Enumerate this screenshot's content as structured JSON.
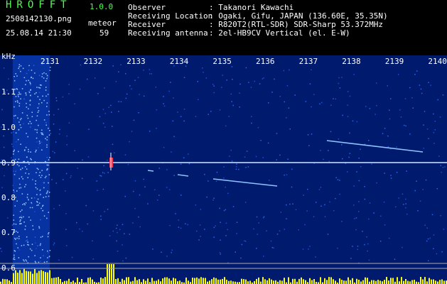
{
  "header": {
    "logo": "HROFFT",
    "version": "1.0.0",
    "filename": "2508142130.png",
    "datetime": "25.08.14 21:30",
    "event_label": "meteor",
    "event_count": "59"
  },
  "meta": [
    {
      "key": "Observer",
      "value": ": Takanori Kawachi"
    },
    {
      "key": "Receiving Location",
      "value": ": Ogaki, Gifu, JAPAN (136.60E, 35.35N)"
    },
    {
      "key": "Receiver",
      "value": ": R820T2(RTL-SDR) SDR-Sharp 53.372MHz"
    },
    {
      "key": "Receiving antenna",
      "value": ": 2el-HB9CV Vertical (el. E-W)"
    }
  ],
  "axis": {
    "y_unit": "kHz",
    "y_ticks": [
      "1.1",
      "1.0",
      "0.9",
      "0.8",
      "0.7",
      "0.6"
    ],
    "x_ticks": [
      "2131",
      "2132",
      "2133",
      "2134",
      "2135",
      "2136",
      "2137",
      "2138",
      "2139",
      "2140"
    ]
  },
  "colors": {
    "background": "#000000",
    "spectrum_bg": "#001a6e",
    "carrier": "#cfe8ff",
    "meteor_trail": "#8fc4ff",
    "histogram": "#ffff00",
    "logo": "#4cff4c"
  }
}
